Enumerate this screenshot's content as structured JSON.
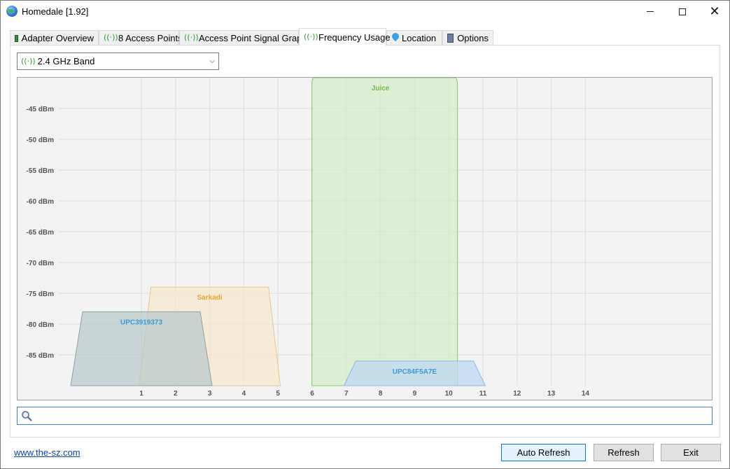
{
  "window": {
    "title": "Homedale [1.92]"
  },
  "tabs": [
    {
      "label": "Adapter Overview",
      "icon": "adapter-icon"
    },
    {
      "label": "8 Access Points",
      "icon": "antenna-icon"
    },
    {
      "label": "Access Point Signal Graph",
      "icon": "antenna-icon"
    },
    {
      "label": "Frequency Usage",
      "icon": "antenna-icon",
      "active": true
    },
    {
      "label": "Location",
      "icon": "location-pin-icon"
    },
    {
      "label": "Options",
      "icon": "options-icon"
    }
  ],
  "band_select": {
    "value": "2.4 GHz Band"
  },
  "search": {
    "placeholder": ""
  },
  "footer": {
    "link": "www.the-sz.com",
    "auto_refresh": "Auto Refresh",
    "refresh": "Refresh",
    "exit": "Exit"
  },
  "chart_data": {
    "type": "area",
    "title": "",
    "xlabel": "",
    "ylabel": "",
    "x_ticks": [
      "1",
      "2",
      "3",
      "4",
      "5",
      "6",
      "7",
      "8",
      "9",
      "10",
      "11",
      "12",
      "13",
      "14"
    ],
    "y_ticks": [
      "-45 dBm",
      "-50 dBm",
      "-55 dBm",
      "-60 dBm",
      "-65 dBm",
      "-70 dBm",
      "-75 dBm",
      "-80 dBm",
      "-85 dBm"
    ],
    "y_values": [
      -45,
      -50,
      -55,
      -60,
      -65,
      -70,
      -75,
      -80,
      -85
    ],
    "ylim": [
      -90,
      -40
    ],
    "grid": true,
    "networks": [
      {
        "name": "Juice",
        "channel": 8,
        "signal_dbm": -40,
        "color": "#7ec96a",
        "fill": "#d2ecc8",
        "label_color": "#6cc24a"
      },
      {
        "name": "Sarkadi",
        "channel": 3,
        "signal_dbm": -74,
        "color": "#e6c98a",
        "fill": "#f5e8cc",
        "label_color": "#e0a830"
      },
      {
        "name": "UPC3919373",
        "channel": 1,
        "signal_dbm": -78,
        "color": "#8fa3a8",
        "fill": "#b8c8ca",
        "label_color": "#3a9ad9"
      },
      {
        "name": "UPC84F5A7E",
        "channel": 9,
        "signal_dbm": -86,
        "color": "#8ab8e8",
        "fill": "#bcd8f3",
        "label_color": "#3a9ad9"
      }
    ]
  }
}
